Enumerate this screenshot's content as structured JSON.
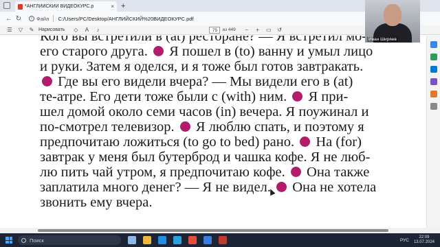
{
  "browser": {
    "tab_title": "*АНГЛИЙСКИЙ ВИДЕОКУРС.р",
    "tab_close": "×",
    "new_tab": "+",
    "file_label": "Файл",
    "url": "C:/Users/PC/Desktop/АНГЛИЙСКИЙ%20ВИДЕОКУРС.pdf"
  },
  "pdf_toolbar": {
    "draw_label": "Нарисовать",
    "page_current": "75",
    "page_total": "из 449"
  },
  "document": {
    "lines": [
      "Кого вы встретили в (at) ресторане? — Я встретил мо-",
      "его старого друга.",
      "Я пошел в (to) ванну и умыл лицо",
      "и руки. Затем я оделся, и я тоже был готов завтракать.",
      "Где вы его видели вчера? — Мы видели его в (at)",
      "те-атре. Его дети тоже были с (with) ним.",
      "Я при-",
      "шел домой около семи часов (in) вечера. Я поужинал и",
      "по-смотрел телевизор.",
      "Я люблю спать, и поэтому я",
      "предпочитаю ложиться (to go to bed) рано.",
      "На (for)",
      "завтрак у меня был бутерброд и чашка кофе. Я не люб-",
      "лю пить чай утром, я предпочитаю кофе.",
      "Она также",
      "заплатила много денег? — Я не видел.",
      "Она не хотела",
      "звонить ему вчера."
    ],
    "bullet_color": "#b31c6a"
  },
  "webcam": {
    "name": "Иван Ширяев"
  },
  "taskbar": {
    "search_placeholder": "Поиск",
    "lang": "РУС",
    "time": "22:09",
    "date": "13.07.2024"
  }
}
